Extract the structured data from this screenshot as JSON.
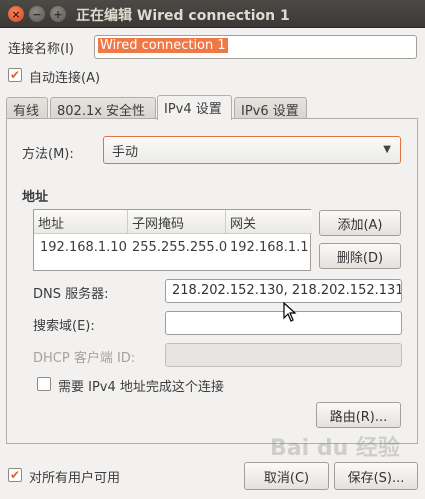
{
  "window": {
    "title": "正在编辑 Wired connection 1",
    "close_glyph": "×",
    "minimize_glyph": "−",
    "maximize_glyph": "+"
  },
  "connection_name": {
    "label": "连接名称(I)",
    "value": "Wired connection 1"
  },
  "auto_connect": {
    "label": "自动连接(A)",
    "checked": true
  },
  "tabs": [
    {
      "label": "有线",
      "active": false
    },
    {
      "label": "802.1x 安全性",
      "active": false
    },
    {
      "label": "IPv4 设置",
      "active": true
    },
    {
      "label": "IPv6 设置",
      "active": false
    }
  ],
  "method": {
    "label": "方法(M):",
    "value": "手动"
  },
  "address_section": {
    "title": "地址",
    "columns": [
      "地址",
      "子网掩码",
      "网关"
    ],
    "rows": [
      [
        "192.168.1.10",
        "255.255.255.0",
        "192.168.1.1"
      ]
    ],
    "add_label": "添加(A)",
    "delete_label": "删除(D)"
  },
  "dns": {
    "label": "DNS 服务器:",
    "value": "218.202.152.130, 218.202.152.131"
  },
  "search_domains": {
    "label": "搜索域(E):",
    "value": ""
  },
  "dhcp_client_id": {
    "label": "DHCP 客户端 ID:",
    "value": ""
  },
  "require_ipv4": {
    "label": "需要 IPv4 地址完成这个连接",
    "checked": false
  },
  "routes_label": "路由(R)...",
  "all_users": {
    "label": "对所有用户可用",
    "checked": true
  },
  "cancel_label": "取消(C)",
  "save_label": "保存(S)...",
  "watermark": "Bai du 经验",
  "colors": {
    "accent": "#f07746",
    "titlebar": "#3c3b37",
    "check": "#e05f2a"
  },
  "icons": {
    "check": "✔",
    "dropdown": "▼"
  }
}
